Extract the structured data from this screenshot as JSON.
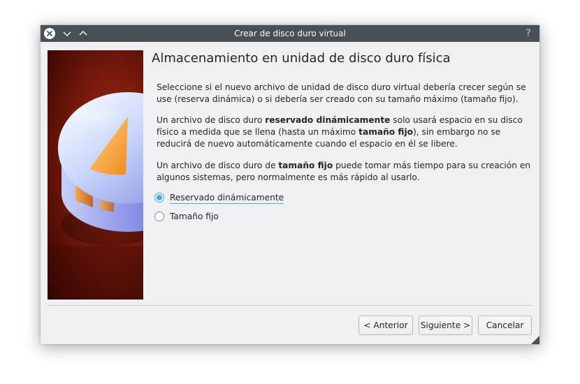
{
  "window": {
    "title": "Crear de disco duro virtual",
    "help_label": "?"
  },
  "page": {
    "heading": "Almacenamiento en unidad de disco duro física",
    "p1": "Seleccione si el nuevo archivo de unidad de disco duro virtual debería crecer según se use (reserva dinámica) o si debería ser creado con su tamaño máximo (tamaño fijo).",
    "p2": {
      "t1": "Un archivo de disco duro ",
      "b1": "reservado dinámicamente",
      "t2": " solo usará espacio en su disco físico a medida que se llena (hasta un máximo ",
      "b2": "tamaño fijo",
      "t3": "), sin embargo no se reducirá de nuevo automáticamente cuando el espacio en él se libere."
    },
    "p3": {
      "t1": "Un archivo de disco duro de ",
      "b1": "tamaño fijo",
      "t2": " puede tomar más tiempo para su creación en algunos sistemas, pero normalmente es más rápido al usarlo."
    }
  },
  "options": [
    {
      "label": "Reservado dinámicamente",
      "checked": true
    },
    {
      "label": "Tamaño fijo",
      "checked": false
    }
  ],
  "buttons": {
    "back": "< Anterior",
    "next": "Siguiente >",
    "cancel": "Cancelar"
  },
  "colors": {
    "titlebar": "#475057",
    "accent": "#3daee9",
    "window_bg": "#eff0f1"
  }
}
